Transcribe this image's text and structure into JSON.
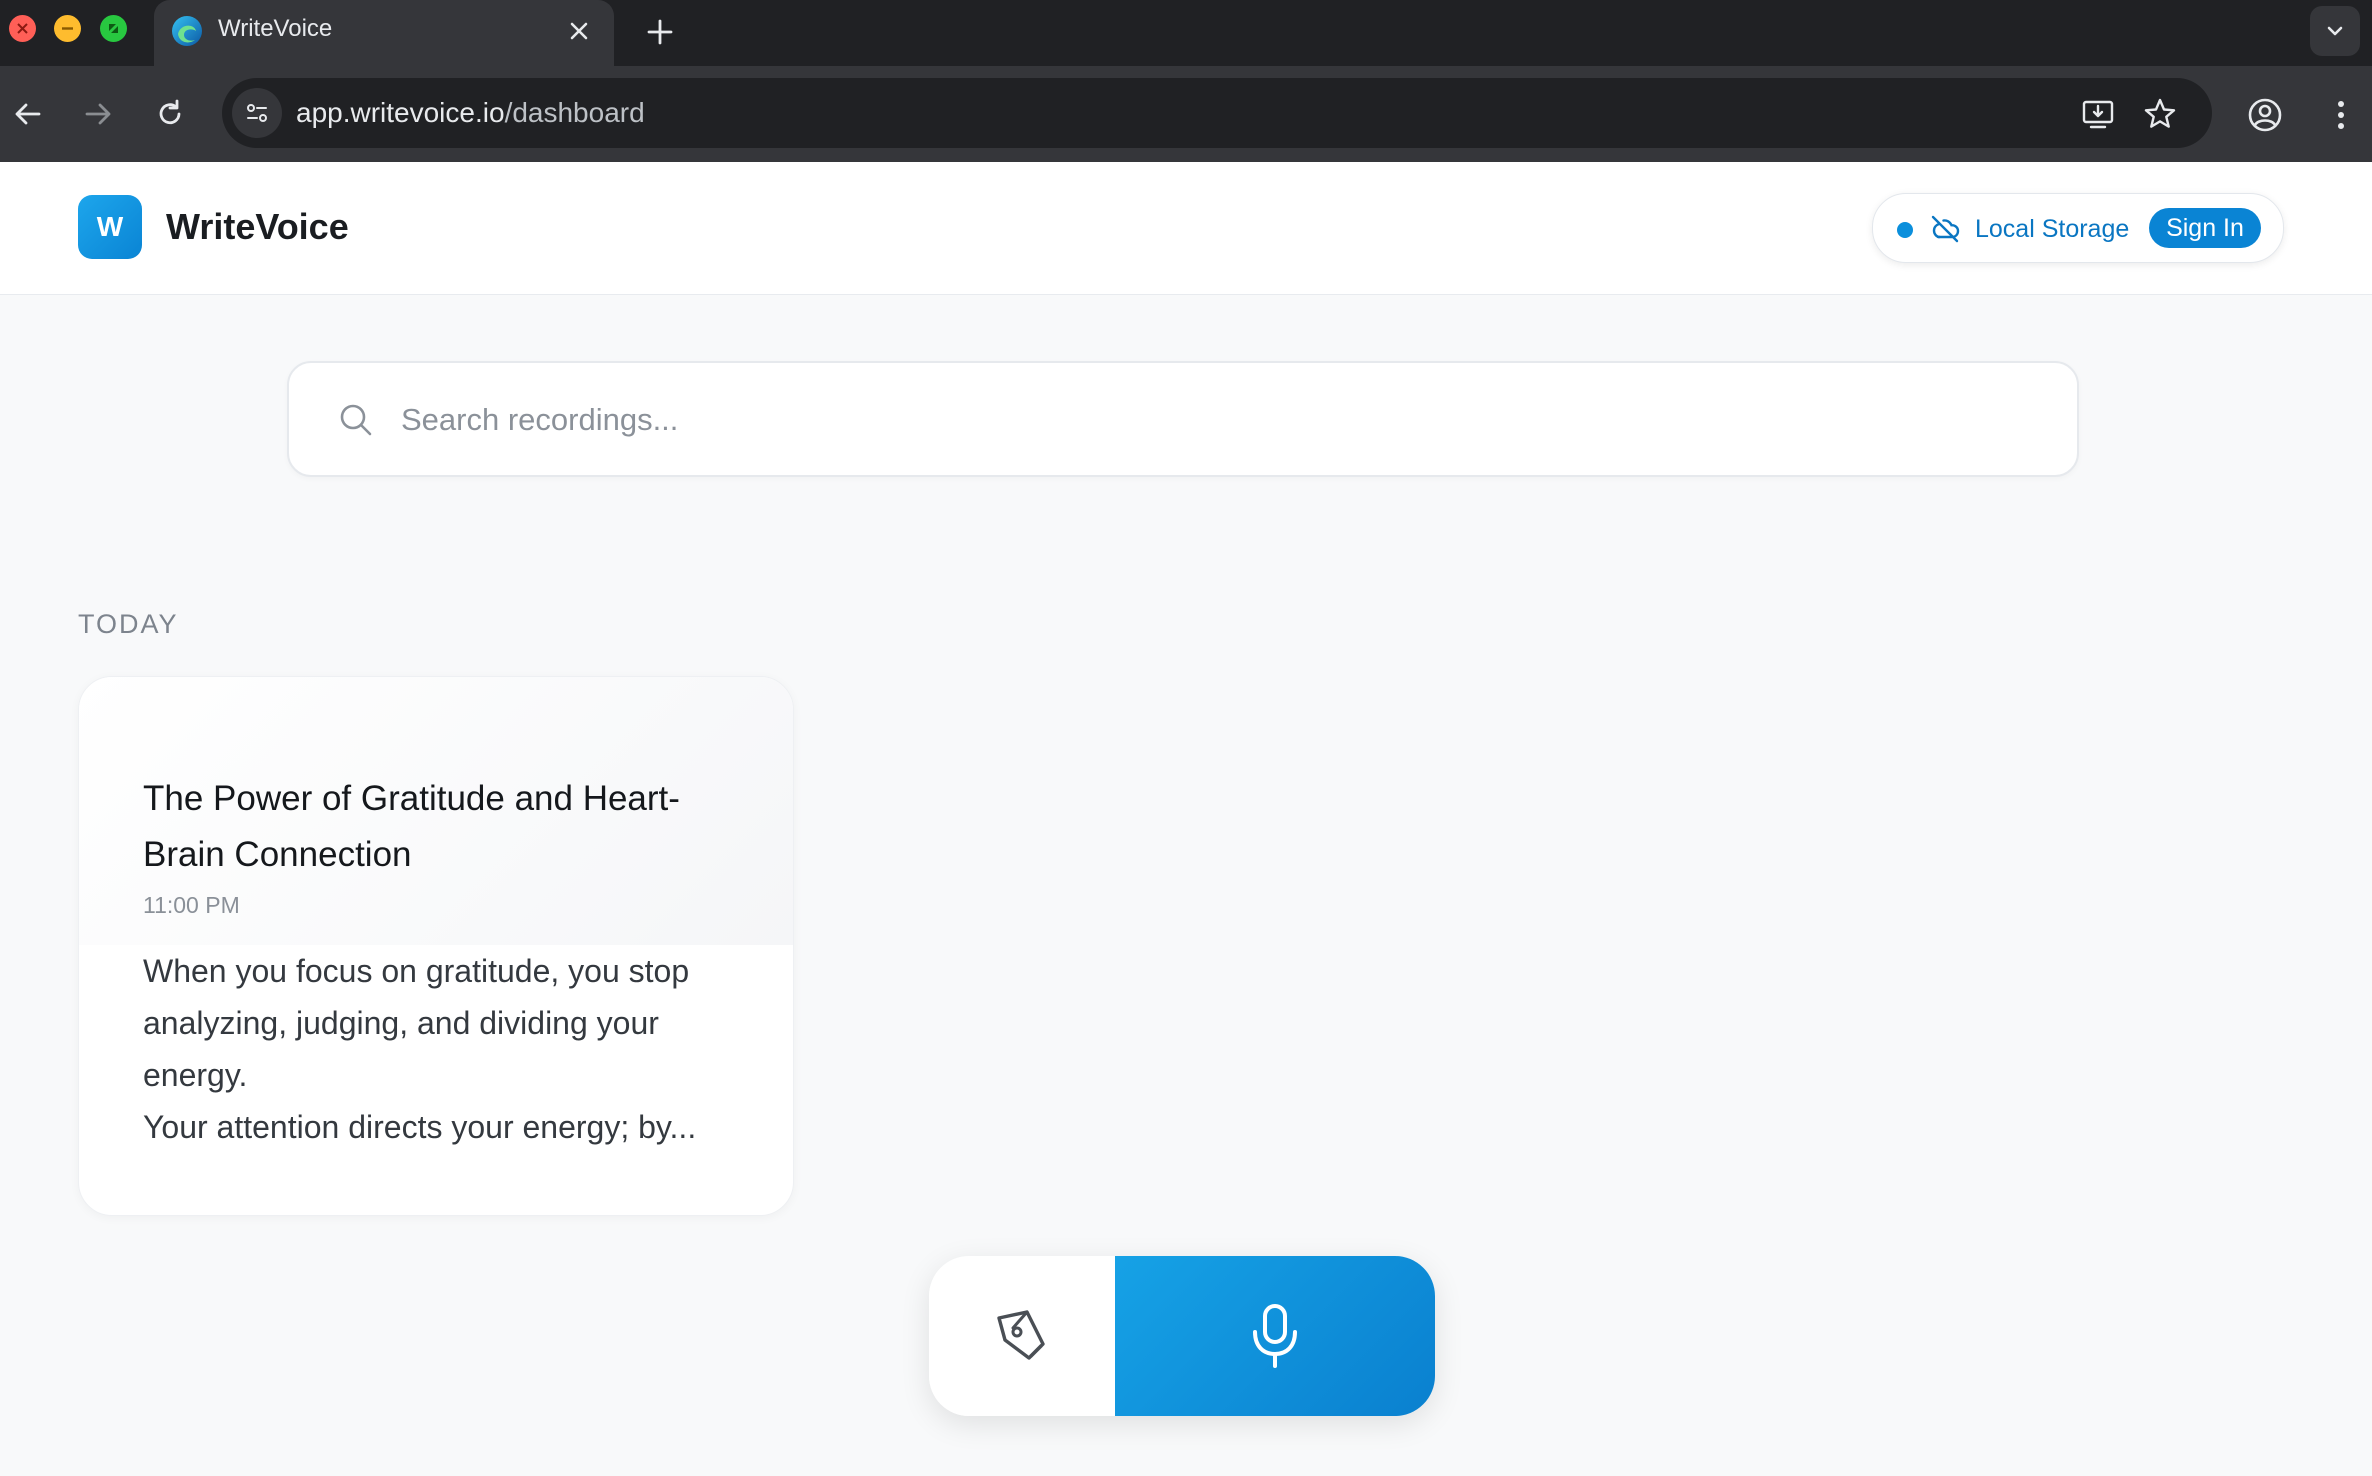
{
  "browser": {
    "tab_title": "WriteVoice",
    "url_host": "app.writevoice.io",
    "url_path": "/dashboard",
    "icons": [
      "close-icon",
      "plus-icon",
      "chevron-down-icon",
      "back-arrow-icon",
      "forward-arrow-icon",
      "reload-icon",
      "site-info-icon",
      "install-app-icon",
      "star-icon",
      "profile-icon",
      "more-vert-icon"
    ]
  },
  "header": {
    "logo_letter": "W",
    "brand": "WriteVoice",
    "storage_label": "Local Storage",
    "sign_in_label": "Sign In",
    "accent_color": "#0a84d4"
  },
  "search": {
    "placeholder": "Search recordings..."
  },
  "sections": [
    {
      "label": "TODAY",
      "cards": [
        {
          "title": "The Power of Gratitude and Heart-Brain Connection",
          "time": "11:00 PM",
          "excerpt": "When you focus on gratitude, you stop analyzing, judging, and dividing your energy.\nYour attention directs your energy; by..."
        }
      ]
    }
  ],
  "actions": {
    "write_icon": "pen-icon",
    "record_icon": "microphone-icon"
  }
}
